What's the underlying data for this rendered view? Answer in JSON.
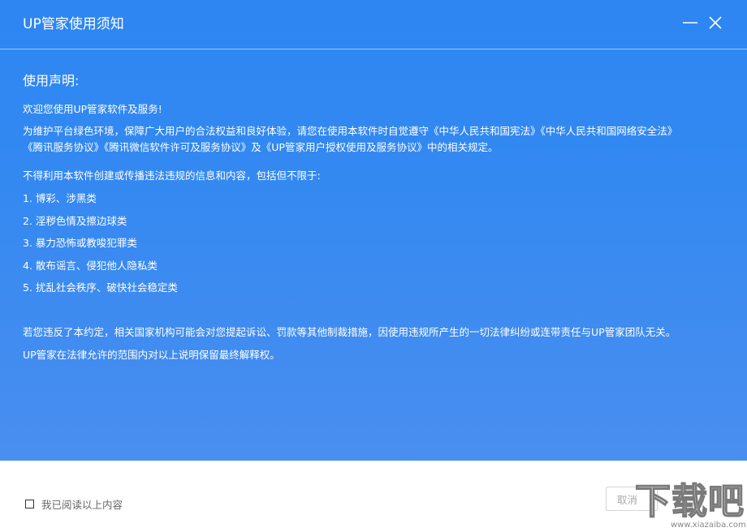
{
  "window": {
    "title": "UP管家使用须知"
  },
  "notice": {
    "heading": "使用声明:",
    "intro": "欢迎您使用UP管家软件及服务!",
    "paragraph1_line1": "为维护平台绿色环境，保障广大用户的合法权益和良好体验，请您在使用本软件时自觉遵守《中华人民共和国宪法》《中华人民共和国网络安全法》",
    "paragraph1_line2": "《腾讯服务协议》《腾讯微信软件许可及服务协议》及《UP管家用户授权使用及服务协议》中的相关规定。",
    "paragraph2": "不得利用本软件创建或传播违法违规的信息和内容，包括但不限于:",
    "prohibited_items": [
      "1. 博彩、涉黑类",
      "2. 淫秽色情及擦边球类",
      "3. 暴力恐怖或教唆犯罪类",
      "4. 散布谣言、侵犯他人隐私类",
      "5. 扰乱社会秩序、破快社会稳定类"
    ],
    "closing1": "若您违反了本约定，相关国家机构可能会对您提起诉讼、罚款等其他制裁措施，因使用违规所产生的一切法律纠纷或连带责任与UP管家团队无关。",
    "closing2": "UP管家在法律允许的范围内对以上说明保留最终解释权。"
  },
  "footer": {
    "checkbox_label": "我已阅读以上内容",
    "checkbox_checked": false,
    "cancel_label": "取消"
  },
  "watermark": {
    "main": "下载吧",
    "sub": "www.xiazaiba.com"
  },
  "colors": {
    "header_blue": "#2d86f2",
    "header_blue_bottom": "#4a8ef0",
    "text_white": "#ffffff"
  }
}
